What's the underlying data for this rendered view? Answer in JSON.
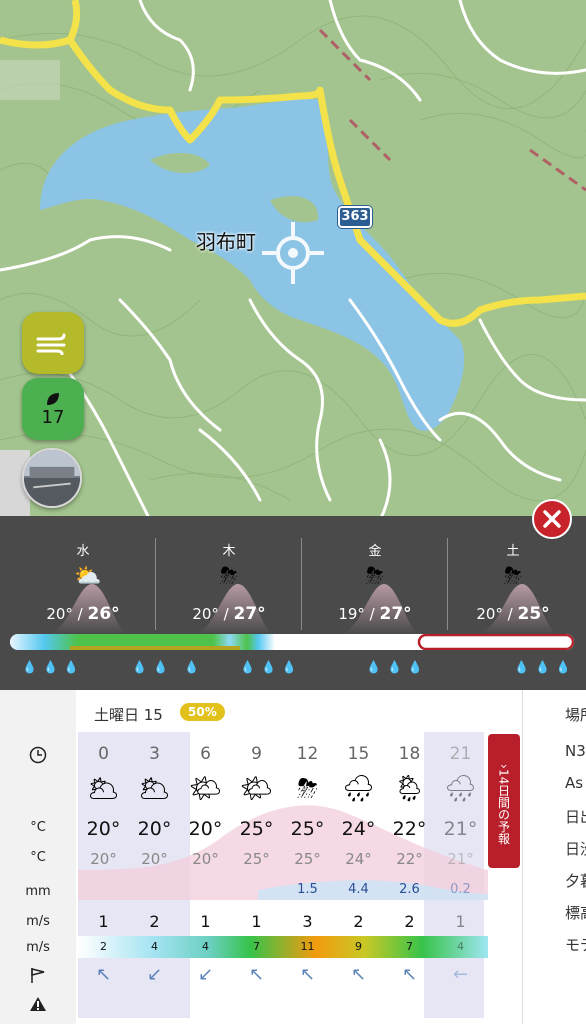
{
  "map": {
    "place_label": "羽布町",
    "road_number": "363",
    "aqi_value": "17",
    "colors": {
      "land": "#9fc28c",
      "water": "#8cc4e6",
      "road": "#f3e24a",
      "path": "#ffffff"
    }
  },
  "days": [
    {
      "name": "水",
      "low": "20°",
      "sep": " / ",
      "high": "26°",
      "icon": "sun-cloud-rain-icon"
    },
    {
      "name": "木",
      "low": "20°",
      "sep": " / ",
      "high": "27°",
      "icon": "cloud-thunder-icon"
    },
    {
      "name": "金",
      "low": "19°",
      "sep": " / ",
      "high": "27°",
      "icon": "cloud-thunder-icon"
    },
    {
      "name": "土",
      "low": "20°",
      "sep": " / ",
      "high": "25°",
      "icon": "cloud-thunder-icon"
    }
  ],
  "hourly": {
    "day_title": "土曜日 15",
    "probability": "50%",
    "units": {
      "time": "clock-icon",
      "temp": "°C",
      "feel": "°C",
      "rain": "mm",
      "wind": "m/s",
      "gust": "m/s",
      "dir": "wind-direction-icon",
      "warn": "warning-icon"
    },
    "hours": [
      {
        "time": "0",
        "icon": "moon-cloud-icon",
        "temp": "20°",
        "feel": "20°",
        "mm": "",
        "wind": "1",
        "gust": "2",
        "dir": "↖"
      },
      {
        "time": "3",
        "icon": "moon-cloud-icon",
        "temp": "20°",
        "feel": "20°",
        "mm": "",
        "wind": "2",
        "gust": "4",
        "dir": "↙"
      },
      {
        "time": "6",
        "icon": "sun-cloud-icon",
        "temp": "20°",
        "feel": "20°",
        "mm": "",
        "wind": "1",
        "gust": "4",
        "dir": "↙"
      },
      {
        "time": "9",
        "icon": "sun-cloud-icon",
        "temp": "25°",
        "feel": "25°",
        "mm": "",
        "wind": "1",
        "gust": "7",
        "dir": "↖"
      },
      {
        "time": "12",
        "icon": "storm-icon",
        "temp": "25°",
        "feel": "25°",
        "mm": "1.5",
        "wind": "3",
        "gust": "11",
        "dir": "↖"
      },
      {
        "time": "15",
        "icon": "rain-icon",
        "temp": "24°",
        "feel": "24°",
        "mm": "4.4",
        "wind": "2",
        "gust": "9",
        "dir": "↖"
      },
      {
        "time": "18",
        "icon": "sun-rain-icon",
        "temp": "22°",
        "feel": "22°",
        "mm": "2.6",
        "wind": "2",
        "gust": "7",
        "dir": "↖"
      },
      {
        "time": "21",
        "icon": "moon-rain-icon",
        "temp": "21°",
        "feel": "21°",
        "mm": "0.2",
        "wind": "1",
        "gust": "4",
        "dir": "←"
      }
    ],
    "side_tab_label": "14日間の予報",
    "right_panel": [
      "場所",
      "N3",
      "As",
      "日出",
      "日没",
      "夕暮",
      "標高",
      "モデ"
    ]
  }
}
